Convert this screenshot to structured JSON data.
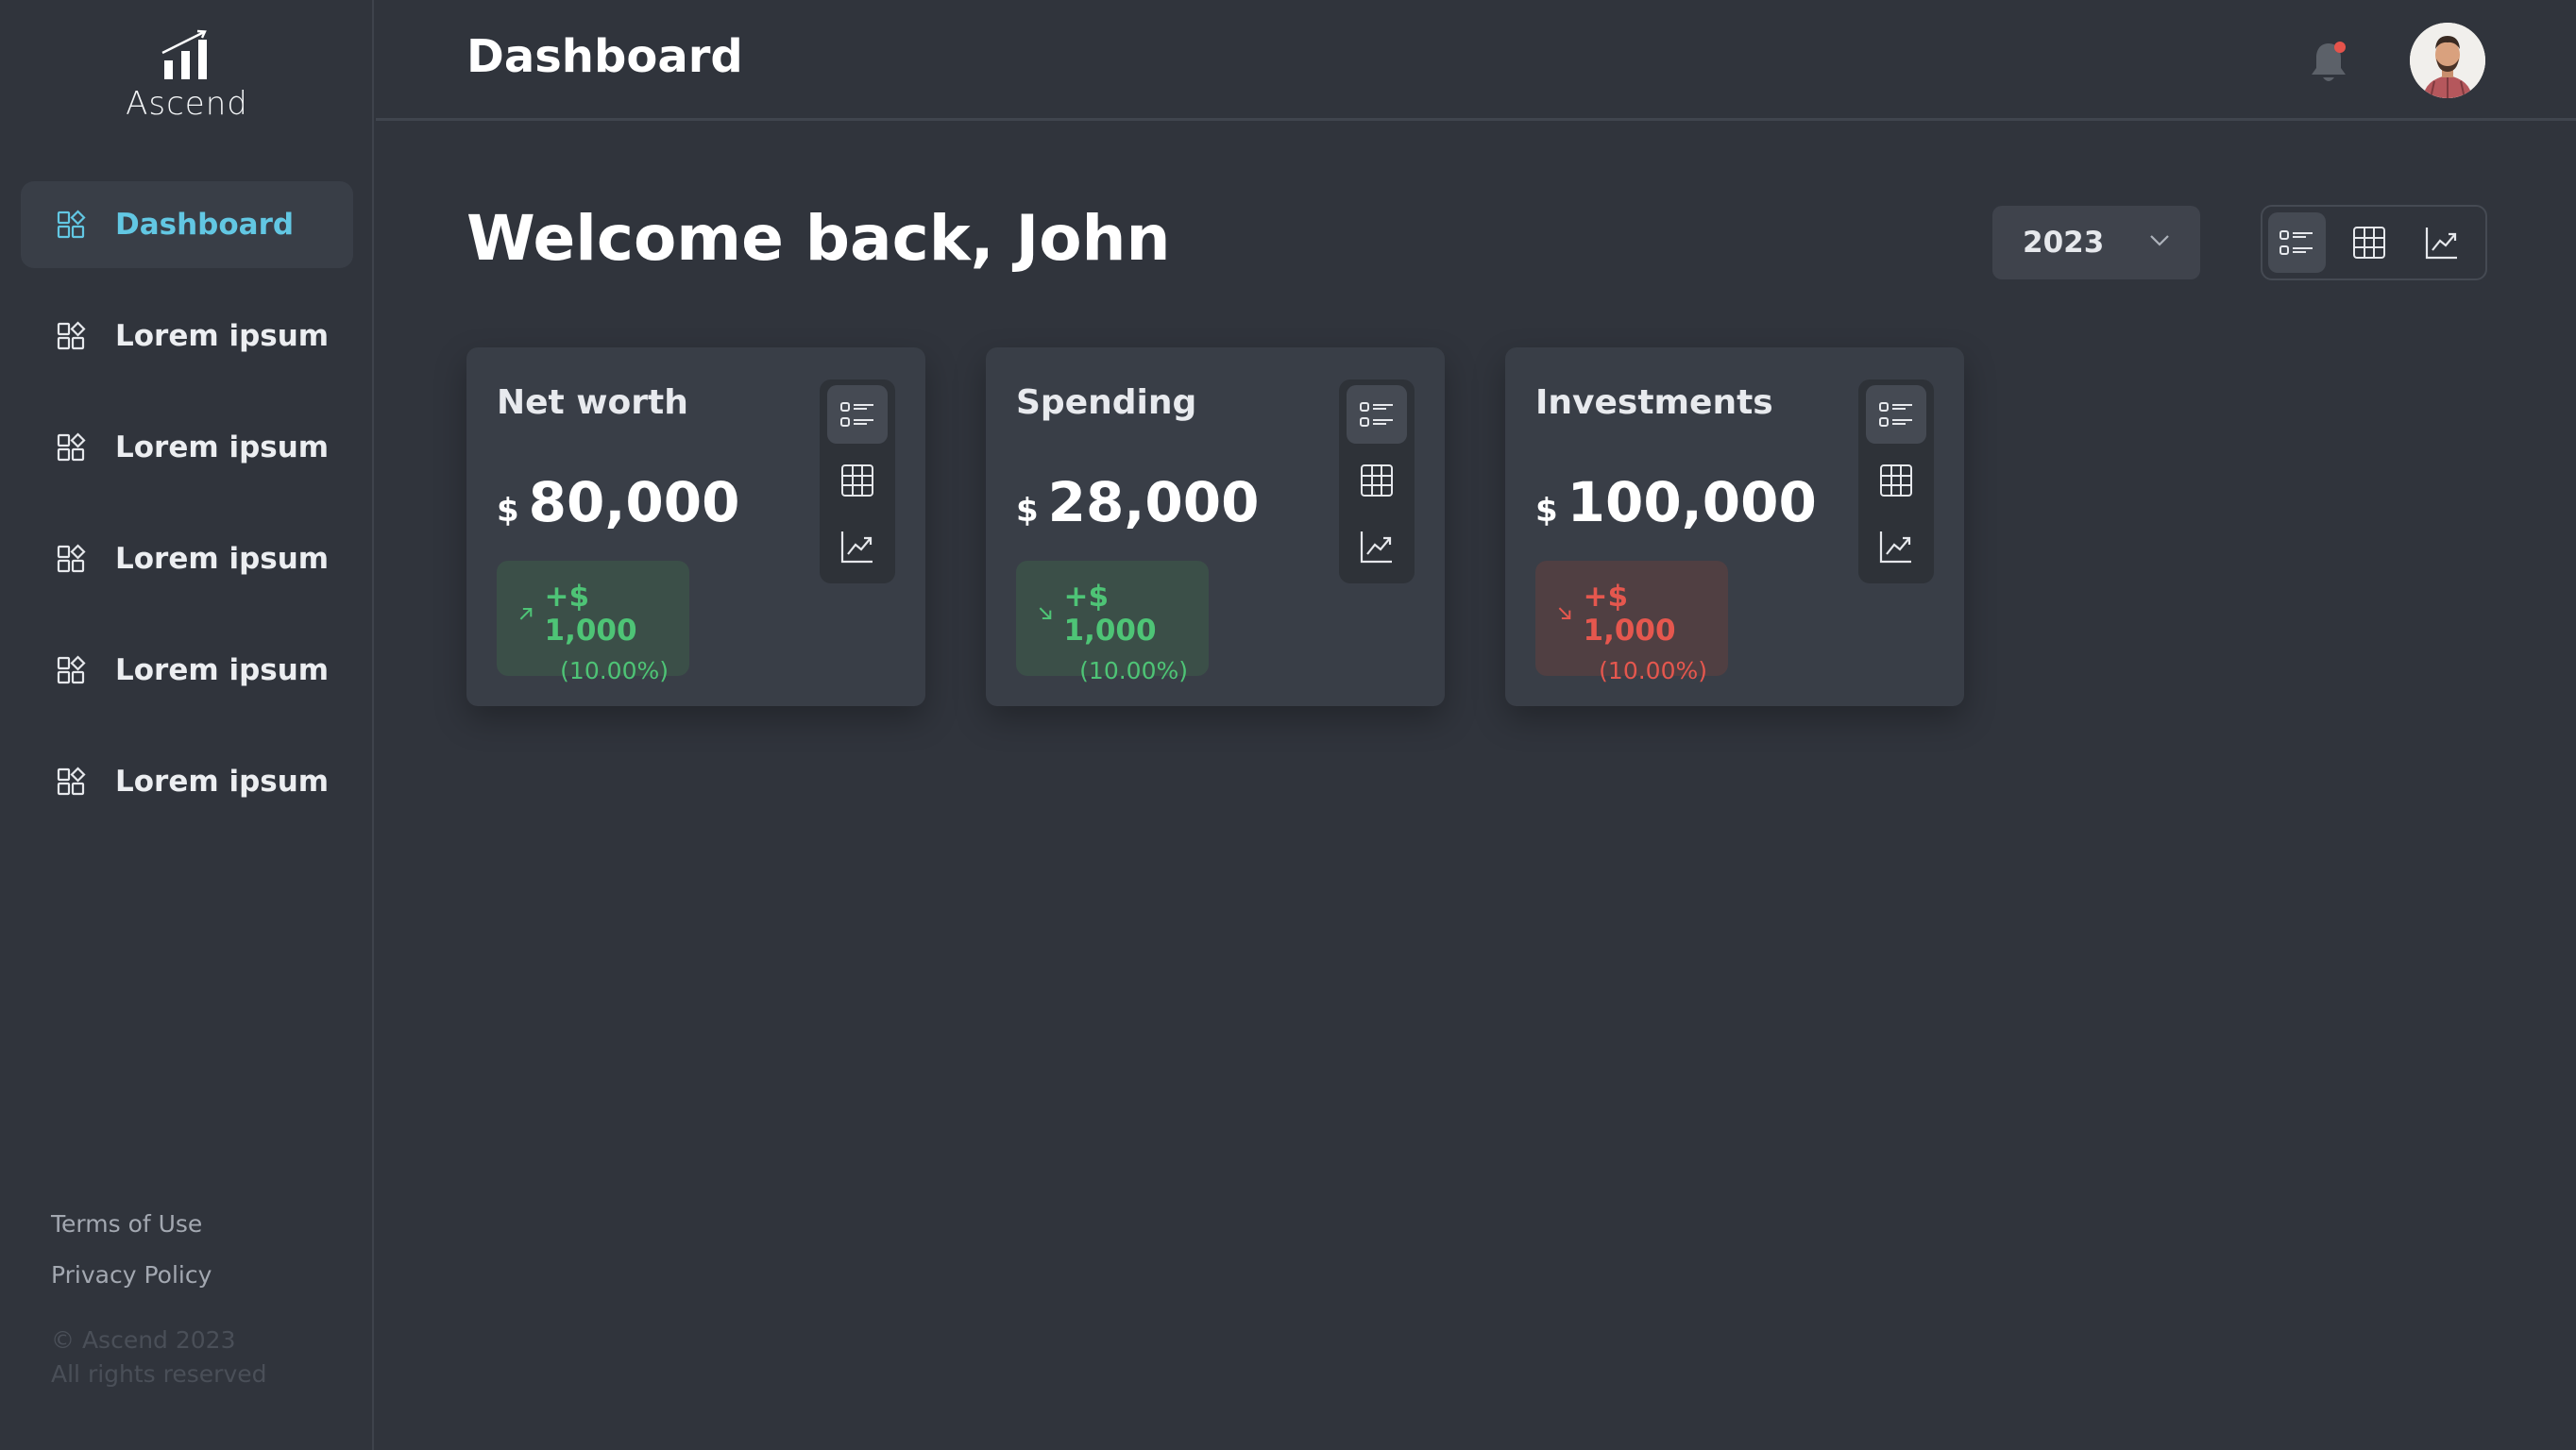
{
  "app": {
    "name": "Ascend"
  },
  "header": {
    "title": "Dashboard"
  },
  "sidebar": {
    "items": [
      {
        "label": "Dashboard",
        "active": true
      },
      {
        "label": "Lorem ipsum"
      },
      {
        "label": "Lorem ipsum"
      },
      {
        "label": "Lorem ipsum"
      },
      {
        "label": "Lorem ipsum"
      },
      {
        "label": "Lorem ipsum"
      }
    ],
    "footer": {
      "terms": "Terms of Use",
      "privacy": "Privacy Policy",
      "copyright_line1": "© Ascend 2023",
      "copyright_line2": "All rights reserved"
    }
  },
  "main": {
    "welcome": "Welcome back, John",
    "year_select": {
      "value": "2023"
    },
    "view_toggle": [
      "list-view-icon",
      "table-view-icon",
      "chart-view-icon"
    ],
    "cards": [
      {
        "title": "Net worth",
        "currency": "$",
        "amount": "80,000",
        "change": "+$ 1,000",
        "change_pct": "(10.00%)",
        "direction": "up"
      },
      {
        "title": "Spending",
        "currency": "$",
        "amount": "28,000",
        "change": "+$ 1,000",
        "change_pct": "(10.00%)",
        "direction": "down"
      },
      {
        "title": "Investments",
        "currency": "$",
        "amount": "100,000",
        "change": "+$ 1,000",
        "change_pct": "(10.00%)",
        "direction": "down"
      }
    ]
  },
  "colors": {
    "accent": "#62c7e3",
    "positive": "#4ec476",
    "negative": "#e5574e",
    "notification_dot": "#e5534b",
    "background": "#30343c",
    "card": "#393e47"
  }
}
